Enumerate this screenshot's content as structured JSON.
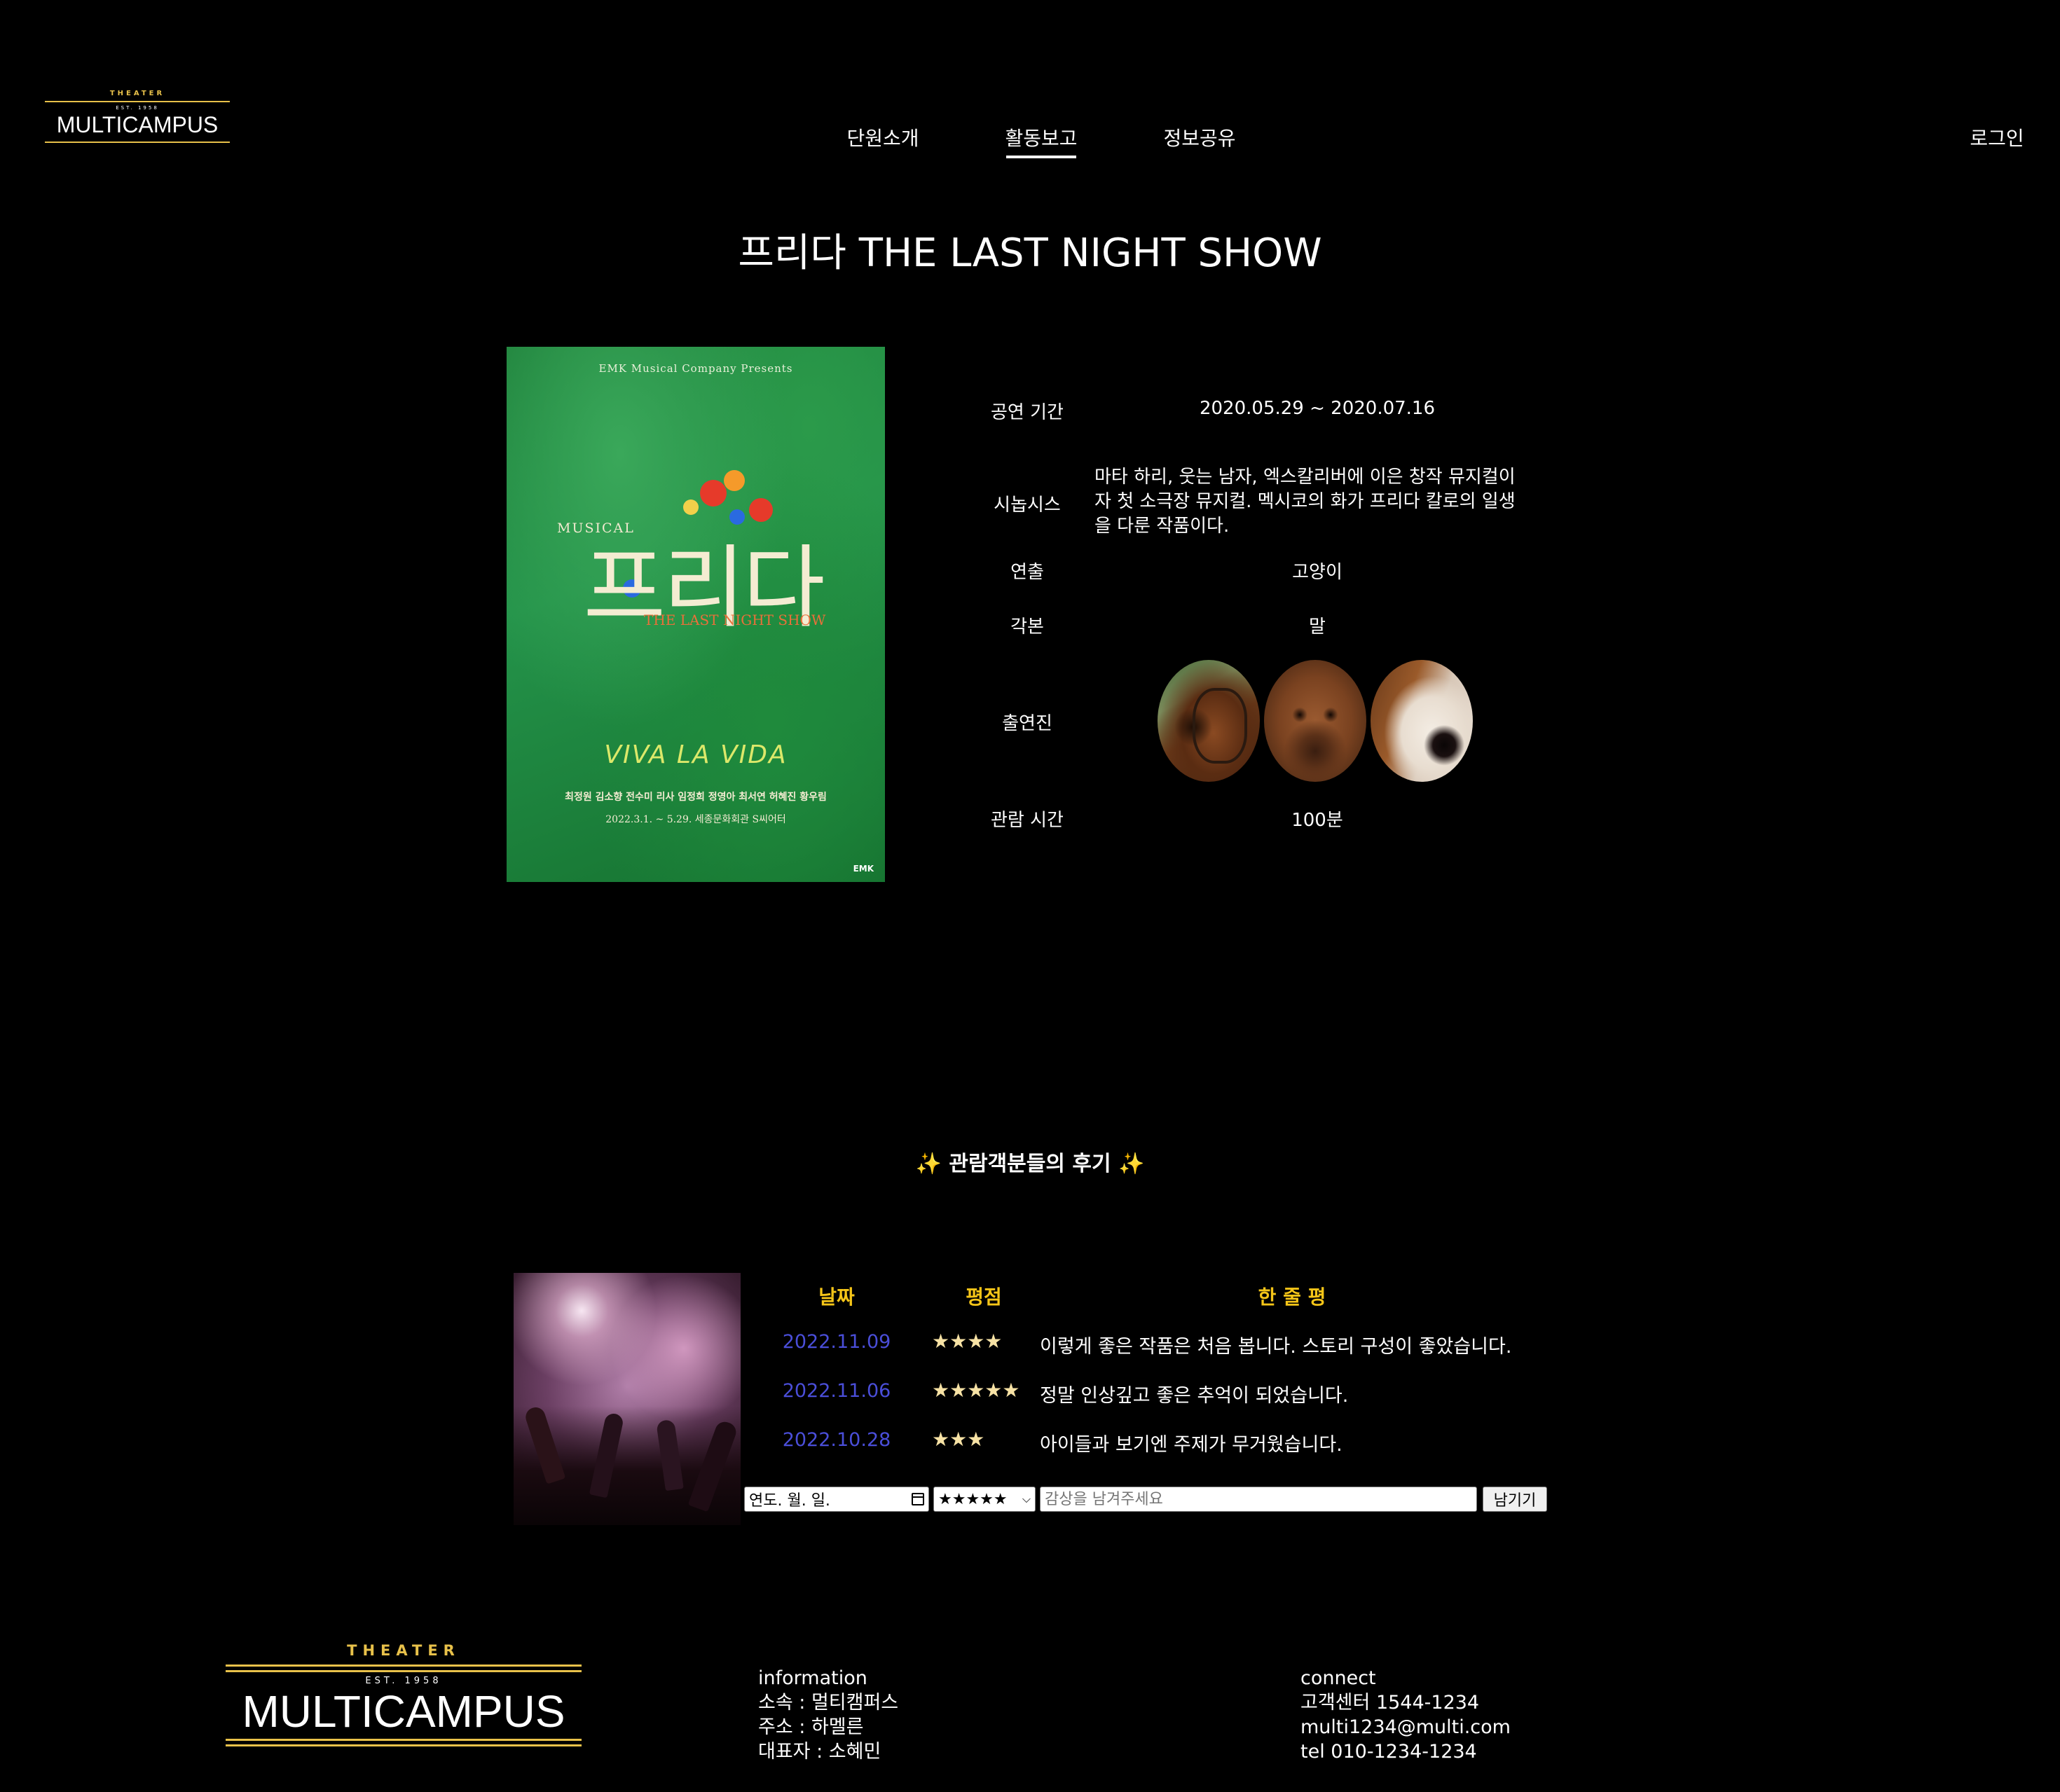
{
  "header": {
    "logo": {
      "theater": "THEATER",
      "est": "EST. 1958",
      "name": "MULTICAMPUS"
    },
    "nav": [
      {
        "label": "단원소개"
      },
      {
        "label": "활동보고"
      },
      {
        "label": "정보공유"
      }
    ],
    "active_nav": "활동보고",
    "login": "로그인"
  },
  "show": {
    "title": "프리다 THE LAST NIGHT SHOW",
    "poster": {
      "company": "EMK Musical Company Presents",
      "musical": "MUSICAL",
      "title": "프리다",
      "subtitle": "THE LAST NIGHT SHOW",
      "tagline": "VIVA LA VIDA",
      "cast": "최정원  김소향  전수미  리사  임정희  정영아  최서연  허혜진  황우림",
      "dates": "2022.3.1. ~ 5.29. 세종문화회관 S씨어터",
      "brand": "EMK"
    },
    "info": [
      {
        "label": "공연 기간",
        "value": "2020.05.29 ~ 2020.07.16"
      },
      {
        "label": "시놉시스",
        "value": "마타 하리, 웃는 남자, 엑스칼리버에 이은 창작 뮤지컬이자 첫 소극장 뮤지컬. 멕시코의 화가 프리다 칼로의 일생을 다룬 작품이다."
      },
      {
        "label": "연출",
        "value": "고양이"
      },
      {
        "label": "각본",
        "value": "말"
      },
      {
        "label": "출연진",
        "value": ""
      },
      {
        "label": "관람 시간",
        "value": "100분"
      }
    ],
    "cast_icons": [
      "horse-photo",
      "cow-photo",
      "dog-photo"
    ]
  },
  "reviews": {
    "heading": "✨ 관람객분들의 후기 ✨",
    "columns": {
      "date": "날짜",
      "rating": "평점",
      "comment": "한 줄 평"
    },
    "rows": [
      {
        "date": "2022.11.09",
        "stars": "★★★★",
        "comment": "이렇게 좋은 작품은 처음 봅니다. 스토리 구성이 좋았습니다."
      },
      {
        "date": "2022.11.06",
        "stars": "★★★★★",
        "comment": "정말 인상깊고 좋은 추억이 되었습니다."
      },
      {
        "date": "2022.10.28",
        "stars": "★★★",
        "comment": "아이들과 보기엔 주제가 무거웠습니다."
      }
    ],
    "form": {
      "date_placeholder": "연도. 월. 일.",
      "rating_selected": "★★★★★",
      "comment_placeholder": "감상을 남겨주세요",
      "submit": "남기기"
    }
  },
  "footer": {
    "logo": {
      "theater": "THEATER",
      "est": "EST. 1958",
      "name": "MULTICAMPUS"
    },
    "information": {
      "title": "information",
      "lines": [
        "소속 : 멀티캠퍼스",
        "주소 : 하멜른",
        "대표자 : 소혜민"
      ]
    },
    "connect": {
      "title": "connect",
      "lines": [
        "고객센터 1544-1234",
        "multi1234@multi.com",
        "tel 010-1234-1234"
      ]
    }
  },
  "colors": {
    "accent_gold": "#e8c14a",
    "review_header": "#f5c518",
    "review_date": "#4a4ed8",
    "background": "#000000"
  }
}
